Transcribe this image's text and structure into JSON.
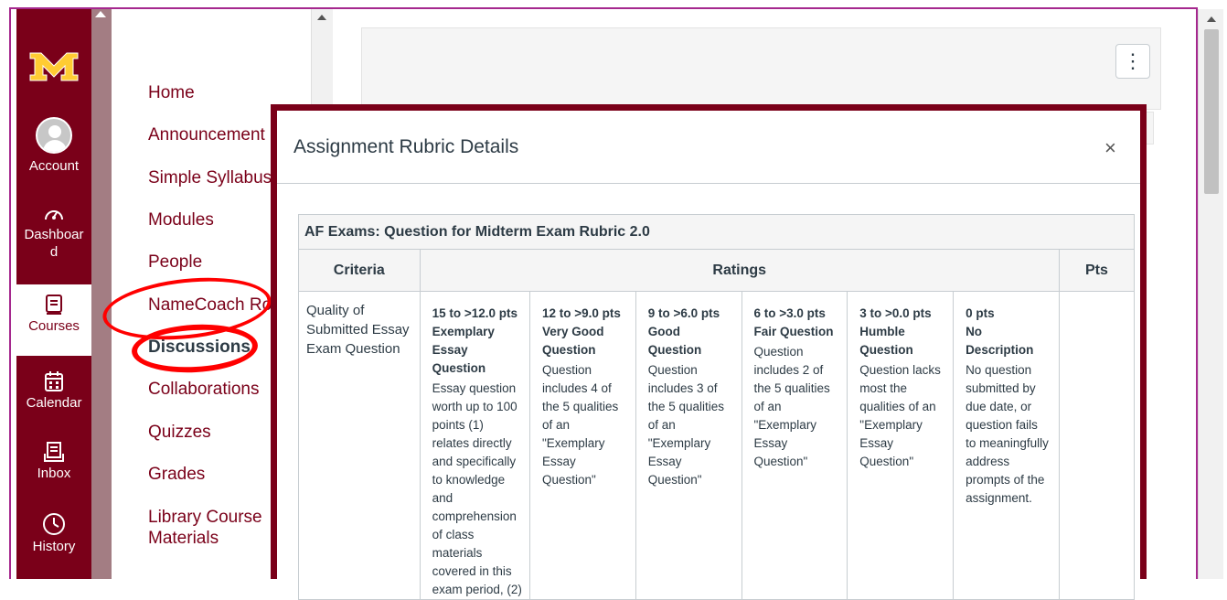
{
  "global_nav": {
    "items": [
      {
        "label": "Account",
        "icon": "account-avatar-icon"
      },
      {
        "label": "Dashboar\nd",
        "icon": "dashboard-speedometer-icon"
      },
      {
        "label": "Courses",
        "icon": "courses-book-icon",
        "active": true
      },
      {
        "label": "Calendar",
        "icon": "calendar-icon"
      },
      {
        "label": "Inbox",
        "icon": "inbox-icon"
      },
      {
        "label": "History",
        "icon": "history-clock-icon"
      }
    ],
    "brand_color": "#7a0019",
    "accent_color": "#ffcc33"
  },
  "course_nav": {
    "items": [
      "Home",
      "Announcement",
      "Simple Syllabus",
      "Modules",
      "People",
      "NameCoach Ro",
      "Discussions",
      "Collaborations",
      "Quizzes",
      "Grades",
      "Library Course\nMaterials"
    ]
  },
  "content": {
    "more_button": "⋮"
  },
  "modal": {
    "title": "Assignment Rubric Details",
    "close": "×",
    "rubric": {
      "title": "AF Exams: Question for Midterm Exam Rubric 2.0",
      "headers": {
        "criteria": "Criteria",
        "ratings": "Ratings",
        "pts": "Pts"
      },
      "criterion": "Quality of Submitted Essay Exam Question",
      "ratings": [
        {
          "points": "15 to >12.0 pts",
          "title": "Exemplary Essay Question",
          "description": "Essay question worth up to 100 points (1) relates directly and specifically to knowledge and comprehension of class materials covered in this exam period, (2)"
        },
        {
          "points": "12 to >9.0 pts",
          "title": "Very Good Question",
          "description": "Question includes 4 of the 5 qualities of an \"Exemplary Essay Question\""
        },
        {
          "points": "9 to >6.0 pts",
          "title": "Good Question",
          "description": "Question includes 3 of the 5 qualities of an \"Exemplary Essay Question\""
        },
        {
          "points": "6 to >3.0 pts",
          "title": "Fair Question",
          "description": "Question includes 2 of the 5 qualities of an \"Exemplary Essay Question\""
        },
        {
          "points": "3 to >0.0 pts",
          "title": "Humble Question",
          "description": "Question lacks most the qualities of an \"Exemplary Essay Question\""
        },
        {
          "points": "0 pts",
          "title": "No Description",
          "description": "No question submitted by due date, or question fails to meaningfully address prompts of the assignment."
        }
      ]
    }
  }
}
